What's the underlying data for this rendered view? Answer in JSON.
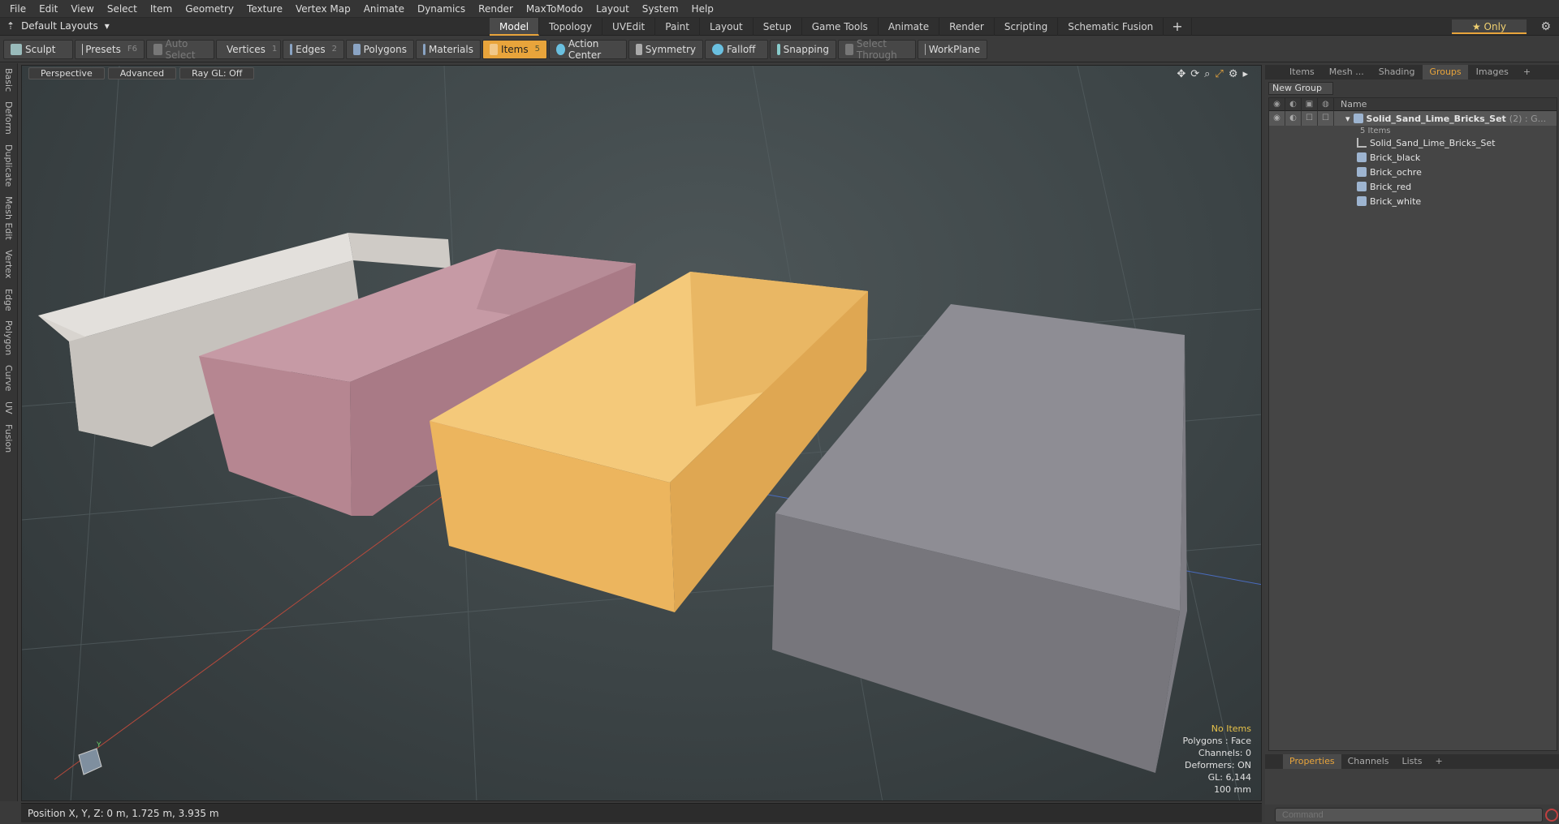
{
  "menu": [
    "File",
    "Edit",
    "View",
    "Select",
    "Item",
    "Geometry",
    "Texture",
    "Vertex Map",
    "Animate",
    "Dynamics",
    "Render",
    "MaxToModo",
    "Layout",
    "System",
    "Help"
  ],
  "layout": {
    "name": "Default Layouts",
    "tabs": [
      "Model",
      "Topology",
      "UVEdit",
      "Paint",
      "Layout",
      "Setup",
      "Game Tools",
      "Animate",
      "Render",
      "Scripting",
      "Schematic Fusion"
    ],
    "active_tab": "Model",
    "only_label": "Only"
  },
  "toolbar": {
    "sculpt": "Sculpt",
    "presets": "Presets",
    "presets_key": "F6",
    "auto_select": "Auto Select",
    "vertices": "Vertices",
    "vertices_key": "1",
    "edges": "Edges",
    "edges_key": "2",
    "polygons": "Polygons",
    "materials": "Materials",
    "items": "Items",
    "items_key": "5",
    "action_center": "Action Center",
    "symmetry": "Symmetry",
    "falloff": "Falloff",
    "snapping": "Snapping",
    "select_through": "Select Through",
    "workplane": "WorkPlane"
  },
  "side_tabs": [
    "Basic",
    "Deform",
    "Duplicate",
    "Mesh Edit",
    "Vertex",
    "Edge",
    "Polygon",
    "Curve",
    "UV",
    "Fusion"
  ],
  "viewport": {
    "view": "Perspective",
    "shading": "Advanced",
    "raygl": "Ray GL: Off",
    "stats": {
      "selection": "No Items",
      "polygons": "Polygons : Face",
      "channels": "Channels: 0",
      "deformers": "Deformers: ON",
      "gl": "GL: 6,144",
      "scale": "100 mm"
    }
  },
  "status": {
    "position": "Position X, Y, Z:   0 m, 1.725 m, 3.935 m"
  },
  "right_panel": {
    "tabs": [
      "Items",
      "Mesh ...",
      "Shading",
      "Groups",
      "Images"
    ],
    "active_tab": "Groups",
    "new_group": "New Group",
    "name_col": "Name",
    "group": {
      "name": "Solid_Sand_Lime_Bricks_Set",
      "suffix": "(2) : G...",
      "count": "5 Items"
    },
    "items": [
      "Solid_Sand_Lime_Bricks_Set",
      "Brick_black",
      "Brick_ochre",
      "Brick_red",
      "Brick_white"
    ],
    "bottom_tabs": [
      "Properties",
      "Channels",
      "Lists"
    ],
    "command_placeholder": "Command"
  },
  "colors": {
    "accent": "#e8a43b",
    "brick_white": "#e6e2dd",
    "brick_red": "#c79aa6",
    "brick_ochre": "#f0c36e",
    "brick_black": "#8a8990"
  }
}
